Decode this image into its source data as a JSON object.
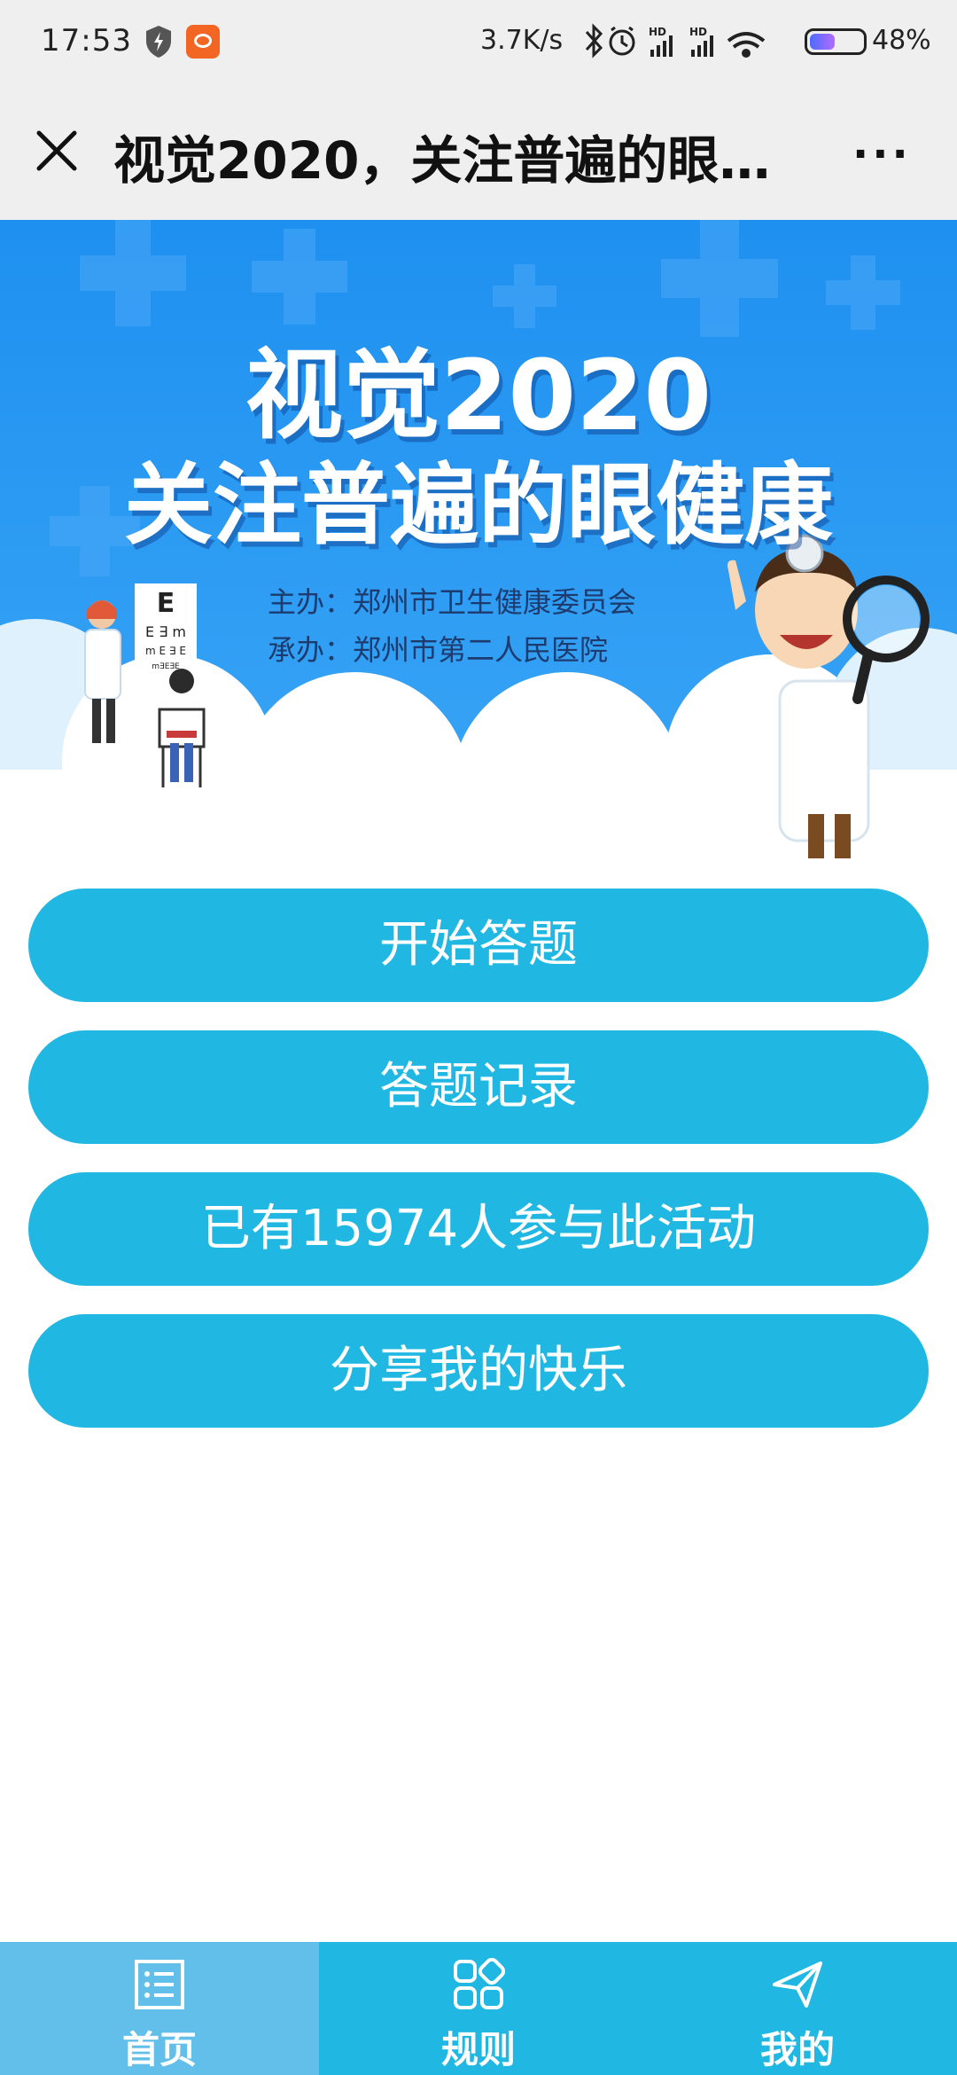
{
  "status_bar": {
    "time": "17:53",
    "net_speed": "3.7K/s",
    "battery_percent": "48%",
    "battery_level": 0.48,
    "icons": [
      "shield-icon",
      "app-notification-icon",
      "bluetooth-icon",
      "alarm-icon",
      "signal-hd-icon",
      "signal-hd-icon",
      "wifi-icon",
      "battery-icon"
    ]
  },
  "title_bar": {
    "title": "视觉2020，关注普遍的眼…",
    "more": "···",
    "close_icon": "close-icon"
  },
  "banner": {
    "title_line1": "视觉2020",
    "title_line2": "关注普遍的眼健康",
    "organizer": "主办：郑州市卫生健康委员会",
    "co_organizer": "承办：郑州市第二人民医院",
    "colors": {
      "sky": "#1e90f0",
      "cloud": "#ffffff"
    }
  },
  "actions": [
    {
      "label": "开始答题"
    },
    {
      "label": "答题记录"
    },
    {
      "label": "已有15974人参与此活动"
    },
    {
      "label": "分享我的快乐"
    }
  ],
  "accent_color": "#20b8e3",
  "bottom_nav": [
    {
      "label": "首页",
      "icon": "list-icon",
      "active": true
    },
    {
      "label": "规则",
      "icon": "grid-icon",
      "active": false
    },
    {
      "label": "我的",
      "icon": "paper-plane-icon",
      "active": false
    }
  ]
}
